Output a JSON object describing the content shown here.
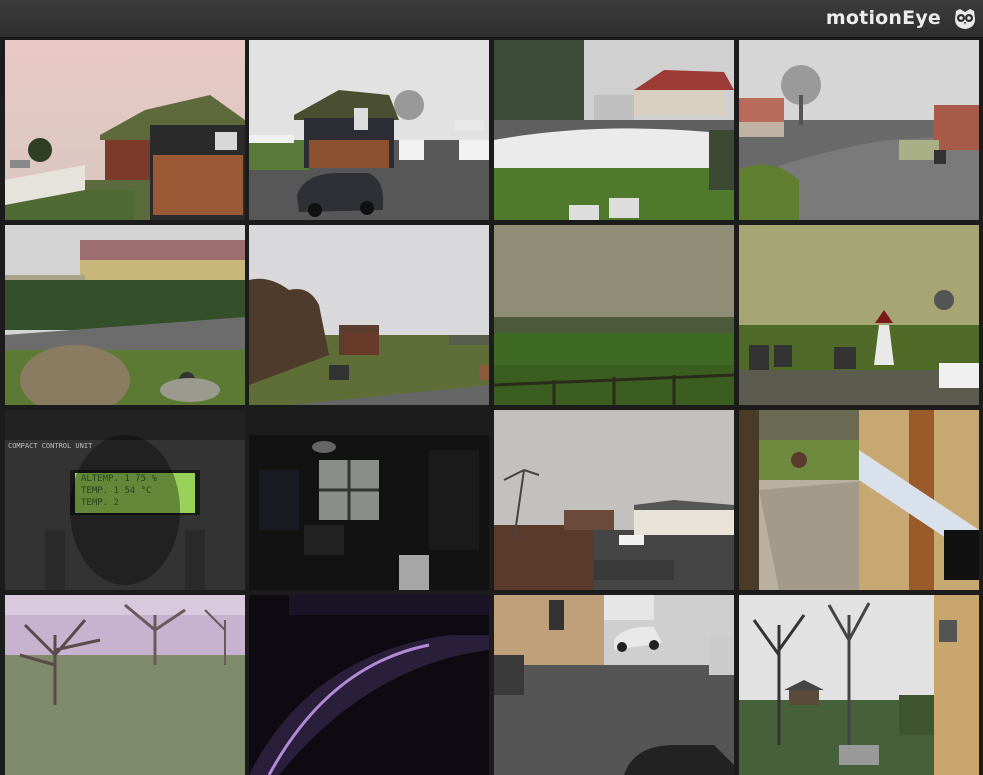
{
  "header": {
    "title": "motionEye",
    "logo_icon": "owl-icon"
  },
  "colors": {
    "header_bg": "#333333",
    "page_bg": "#1c1c1c",
    "brand_text": "#ececec"
  },
  "cameras": [
    {
      "row": 1,
      "col": 1,
      "scene": "thatched-cottage-dusk"
    },
    {
      "row": 1,
      "col": 2,
      "scene": "cottage-with-parked-car"
    },
    {
      "row": 1,
      "col": 3,
      "scene": "white-fence-red-roof-house"
    },
    {
      "row": 1,
      "col": 4,
      "scene": "village-road-bare-tree"
    },
    {
      "row": 2,
      "col": 1,
      "scene": "long-yellow-building-hedge"
    },
    {
      "row": 2,
      "col": 2,
      "scene": "garden-hedge-overcast"
    },
    {
      "row": 2,
      "col": 3,
      "scene": "foggy-green-field"
    },
    {
      "row": 2,
      "col": 4,
      "scene": "field-with-windmill-ornament"
    },
    {
      "row": 3,
      "col": 1,
      "scene": "control-unit-lcd-display",
      "lcd_lines": [
        "COMPACT CONTROL UNIT",
        "ALTEMP.  1 75 %",
        "TEMP.    1 54 °C",
        "TEMP. 2"
      ]
    },
    {
      "row": 3,
      "col": 2,
      "scene": "dark-room-window"
    },
    {
      "row": 3,
      "col": 3,
      "scene": "house-with-bare-tree"
    },
    {
      "row": 3,
      "col": 4,
      "scene": "patio-wooden-post"
    },
    {
      "row": 4,
      "col": 1,
      "scene": "purple-orchard-trees"
    },
    {
      "row": 4,
      "col": 2,
      "scene": "dark-car-interior"
    },
    {
      "row": 4,
      "col": 3,
      "scene": "driveway-parked-car"
    },
    {
      "row": 4,
      "col": 4,
      "scene": "garden-bare-trees-house"
    }
  ]
}
